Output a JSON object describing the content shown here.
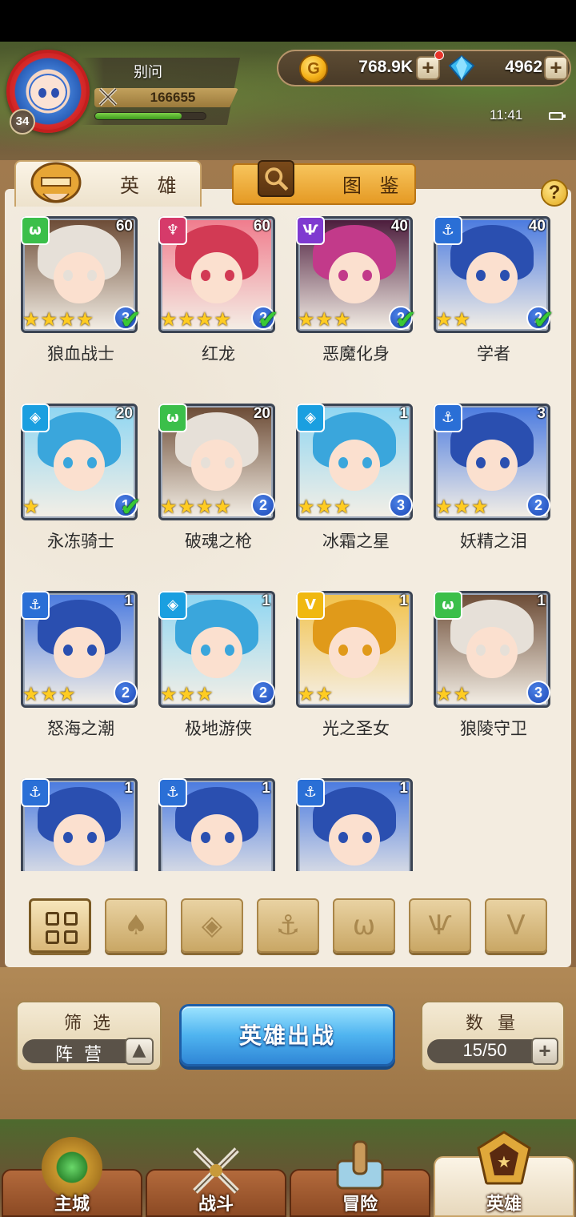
{
  "player": {
    "name": "别问",
    "level": "34",
    "power": "166655",
    "exp_fraction": 0.78
  },
  "currency": {
    "gold": "768.9K",
    "gems": "4962"
  },
  "status": {
    "time": "11:41"
  },
  "tabs": {
    "heroes": "英 雄",
    "codex": "图 鉴"
  },
  "heroes": [
    {
      "name": "狼血战士",
      "level": "60",
      "stars": 4,
      "grade": "3",
      "faction": "beast",
      "deployed": true
    },
    {
      "name": "红龙",
      "level": "60",
      "stars": 4,
      "grade": "2",
      "faction": "flame",
      "deployed": true
    },
    {
      "name": "恶魔化身",
      "level": "40",
      "stars": 3,
      "grade": "2",
      "faction": "demon",
      "deployed": true
    },
    {
      "name": "学者",
      "level": "40",
      "stars": 2,
      "grade": "2",
      "faction": "anchor",
      "deployed": true
    },
    {
      "name": "永冻骑士",
      "level": "20",
      "stars": 1,
      "grade": "1",
      "faction": "crystal",
      "deployed": true
    },
    {
      "name": "破魂之枪",
      "level": "20",
      "stars": 4,
      "grade": "2",
      "faction": "beast",
      "deployed": false
    },
    {
      "name": "冰霜之星",
      "level": "1",
      "stars": 3,
      "grade": "3",
      "faction": "crystal",
      "deployed": false
    },
    {
      "name": "妖精之泪",
      "level": "3",
      "stars": 3,
      "grade": "2",
      "faction": "anchor",
      "deployed": false
    },
    {
      "name": "怒海之潮",
      "level": "1",
      "stars": 3,
      "grade": "2",
      "faction": "anchor",
      "deployed": false
    },
    {
      "name": "极地游侠",
      "level": "1",
      "stars": 3,
      "grade": "2",
      "faction": "crystal",
      "deployed": false
    },
    {
      "name": "光之圣女",
      "level": "1",
      "stars": 2,
      "grade": "",
      "faction": "light",
      "deployed": false
    },
    {
      "name": "狼陵守卫",
      "level": "1",
      "stars": 2,
      "grade": "3",
      "faction": "beast",
      "deployed": false
    },
    {
      "name": "",
      "level": "1",
      "stars": 0,
      "grade": "",
      "faction": "anchor",
      "deployed": false
    },
    {
      "name": "",
      "level": "1",
      "stars": 0,
      "grade": "",
      "faction": "anchor",
      "deployed": false
    },
    {
      "name": "",
      "level": "1",
      "stars": 0,
      "grade": "",
      "faction": "anchor",
      "deployed": false
    }
  ],
  "faction_filters": [
    "all",
    "flame",
    "crystal",
    "anchor",
    "beast",
    "demon",
    "light"
  ],
  "sort": {
    "label": "筛 选",
    "value": "阵 营"
  },
  "deploy_label": "英雄出战",
  "count": {
    "label": "数 量",
    "value": "15/50"
  },
  "nav": {
    "home": "主城",
    "battle": "战斗",
    "adventure": "冒险",
    "hero": "英雄"
  },
  "colors": {
    "parchment": "#f3ece0",
    "wood": "#a17a4e",
    "deploy_blue": "#4fb4f0",
    "star": "#ffcc22"
  }
}
